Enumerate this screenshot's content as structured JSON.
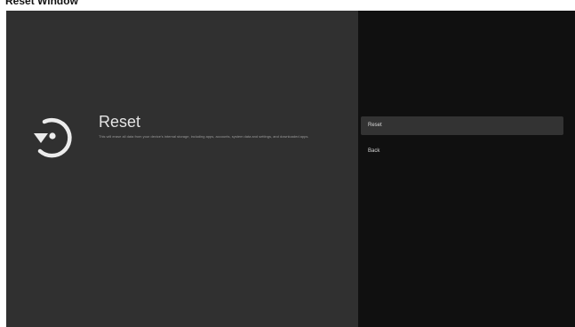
{
  "caption": "Reset Window",
  "settings": {
    "title": "Reset",
    "description": "This will erase all data from your device's internal storage, including apps, accounts, system data and settings, and downloaded apps.",
    "icon": "reset-icon"
  },
  "options": [
    {
      "label": "Reset",
      "focused": true
    },
    {
      "label": "Back",
      "focused": false
    }
  ],
  "colors": {
    "left_pane": "#303030",
    "right_pane": "#101010",
    "focused_option": "#333333"
  }
}
